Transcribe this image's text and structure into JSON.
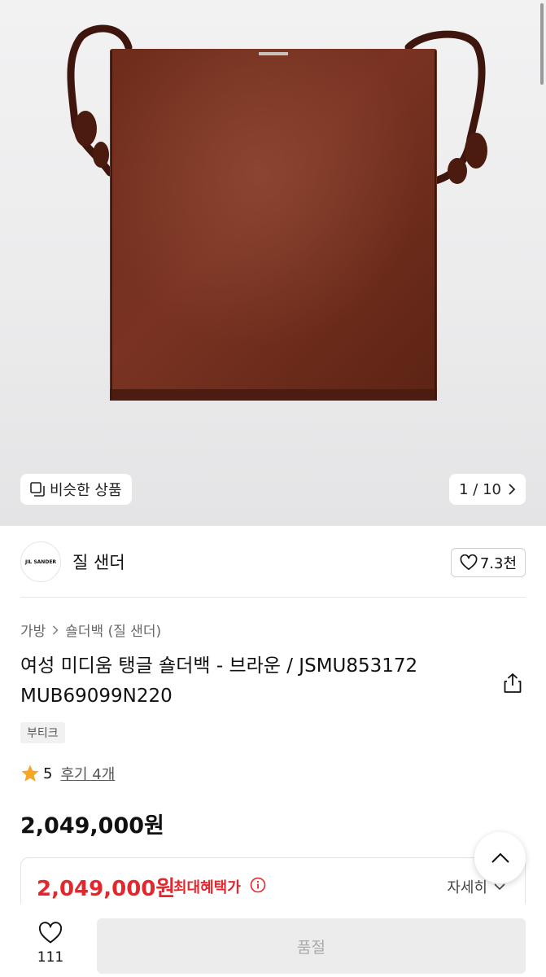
{
  "gallery": {
    "similar_label": "비슷한 상품",
    "pager": "1 / 10"
  },
  "brand": {
    "logo_text": "JIL SANDER",
    "name": "질 샌더",
    "like_count": "7.3천"
  },
  "product": {
    "breadcrumb": [
      "가방",
      "숄더백 (질 샌더)"
    ],
    "title": "여성 미디움 탱글 숄더백 - 브라운 / JSMU853172 MUB69099N220",
    "tag": "부티크",
    "rating": "5",
    "reviews": "후기 4개",
    "price": "2,049,000원"
  },
  "benefit": {
    "price": "2,049,000원",
    "label": "최대혜택가",
    "detail": "자세히"
  },
  "bottom": {
    "wish_count": "111",
    "buy_label": "품절"
  },
  "icons": {
    "similar": "similar-products-icon",
    "pager_next": "chevron-right-icon",
    "like": "heart-icon",
    "share": "share-icon",
    "star": "star-icon",
    "info": "info-icon",
    "expand": "chevron-down-icon",
    "top": "chevron-up-icon"
  },
  "colors": {
    "accent_red": "#e5272d",
    "star": "#f5a623",
    "bag": "#6b2a1a"
  }
}
